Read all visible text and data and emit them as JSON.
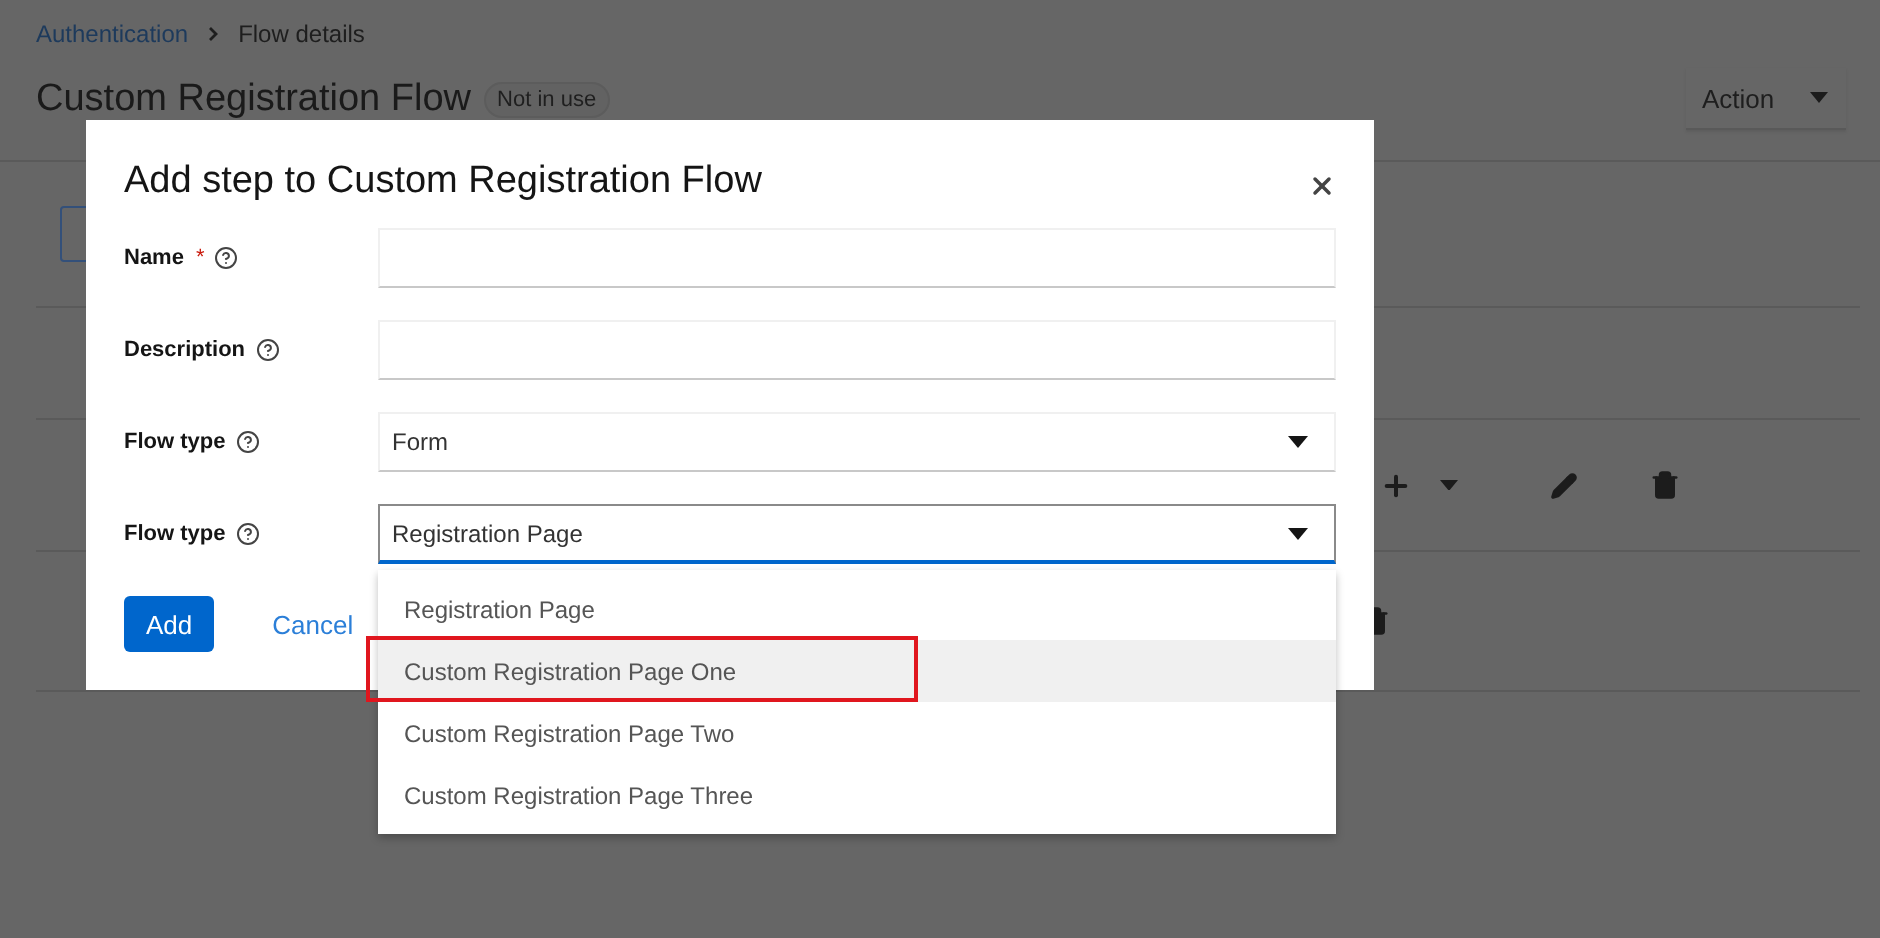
{
  "breadcrumb": [
    {
      "label": "Authentication",
      "kind": "link"
    },
    {
      "label": "Flow details",
      "kind": "current"
    }
  ],
  "page": {
    "title": "Custom Registration Flow",
    "status_badge": "Not in use",
    "action_button": "Action"
  },
  "dialog": {
    "title": "Add step to Custom Registration Flow",
    "required_marker": "*",
    "fields": [
      {
        "label": "Name",
        "kind": "text",
        "required": true
      },
      {
        "label": "Description",
        "kind": "text",
        "required": false
      },
      {
        "label": "Flow type",
        "kind": "select",
        "required": false,
        "value": "Form",
        "expanded": false
      },
      {
        "label": "Flow type",
        "kind": "select",
        "required": false,
        "value": "Registration Page",
        "expanded": true,
        "options": [
          {
            "label": "Registration Page",
            "highlighted": false,
            "annotated": false
          },
          {
            "label": "Custom Registration Page One",
            "highlighted": true,
            "annotated": true
          },
          {
            "label": "Custom Registration Page Two",
            "highlighted": false,
            "annotated": false
          },
          {
            "label": "Custom Registration Page Three",
            "highlighted": false,
            "annotated": false
          }
        ]
      }
    ],
    "buttons": [
      {
        "label": "Add",
        "kind": "primary"
      },
      {
        "label": "Cancel",
        "kind": "link"
      }
    ]
  }
}
